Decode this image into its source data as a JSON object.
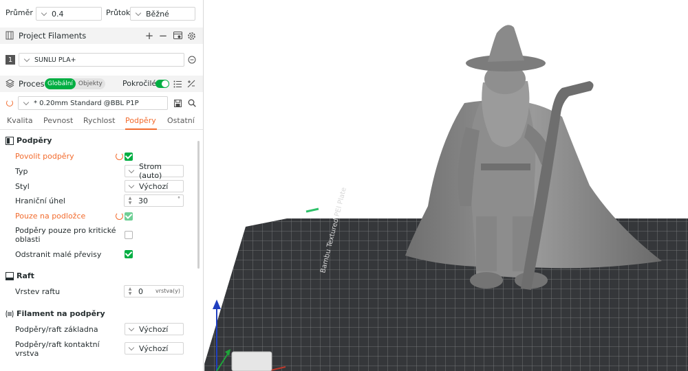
{
  "top": {
    "diameter_label": "Průměr",
    "diameter_value": "0.4",
    "flow_label": "Průtok",
    "flow_value": "Běžné"
  },
  "filaments": {
    "title": "Project Filaments",
    "slot_number": "1",
    "filament_name": "SUNLU PLA+"
  },
  "process": {
    "title": "Proces",
    "global_label": "Globální",
    "objects_label": "Objekty",
    "advanced_label": "Pokročilé",
    "preset_name": "* 0.20mm Standard @BBL P1P"
  },
  "tabs": [
    "Kvalita",
    "Pevnost",
    "Rychlost",
    "Podpěry",
    "Ostatní"
  ],
  "active_tab": "Podpěry",
  "supports": {
    "title": "Podpěry",
    "enable_label": "Povolit podpěry",
    "type_label": "Typ",
    "type_value": "Strom (auto)",
    "style_label": "Styl",
    "style_value": "Výchozí",
    "threshold_label": "Hraniční úhel",
    "threshold_value": "30",
    "threshold_unit": "°",
    "on_plate_label": "Pouze na podložce",
    "critical_label_1": "Podpěry pouze pro kritické",
    "critical_label_2": "oblasti",
    "remove_small_label": "Odstranit malé převisy"
  },
  "raft": {
    "title": "Raft",
    "layers_label": "Vrstev raftu",
    "layers_value": "0",
    "layers_unit": "vrstva(y)"
  },
  "support_filament": {
    "title": "Filament na podpěry",
    "base_label": "Podpěry/raft základna",
    "base_value": "Výchozí",
    "interface_label_1": "Podpěry/raft kontaktní",
    "interface_label_2": "vrstva",
    "interface_value": "Výchozí"
  },
  "viewport": {
    "plate_text": "Bambu Textured PEI Plate"
  },
  "colors": {
    "accent_green": "#00ae42",
    "modified_orange": "#f26b2d",
    "plate_dark": "#35373a",
    "model_gray": "#8c8c8c"
  }
}
